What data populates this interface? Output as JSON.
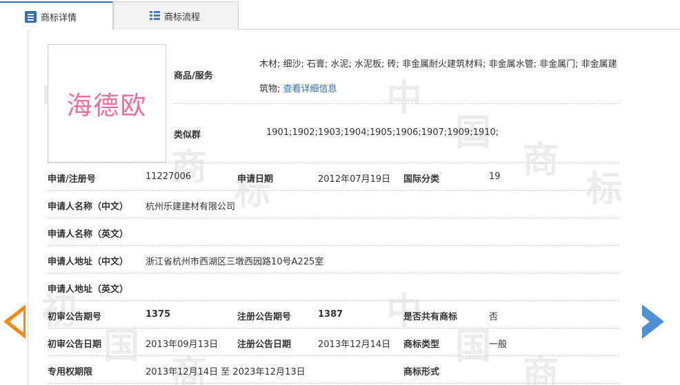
{
  "tabs": [
    {
      "label": "商标详情",
      "active": true,
      "icon": "document-list-icon"
    },
    {
      "label": "商标流程",
      "active": false,
      "icon": "grid-list-icon"
    }
  ],
  "logo": {
    "text": "海德欧"
  },
  "goods": {
    "label": "商品/服务",
    "text": "木材; 细沙; 石膏; 水泥; 水泥板; 砖; 非金属耐火建筑材料; 非金属水管; 非金属门; 非金属建筑物;",
    "link": "查看详细信息"
  },
  "similar_group": {
    "label": "类似群",
    "value": "1901;1902;1903;1904;1905;1906;1907;1909;1910;"
  },
  "fields": {
    "reg_no_label": "申请/注册号",
    "reg_no": "11227006",
    "apply_date_label": "申请日期",
    "apply_date": "2012年07月19日",
    "intl_class_label": "国际分类",
    "intl_class": "19",
    "applicant_cn_label": "申请人名称（中文）",
    "applicant_cn": "杭州乐建建材有限公司",
    "applicant_en_label": "申请人名称（英文）",
    "applicant_en": "",
    "address_cn_label": "申请人地址（中文）",
    "address_cn": "浙江省杭州市西湖区三墩西园路10号A225室",
    "address_en_label": "申请人地址（英文）",
    "address_en": "",
    "prelim_issue_label": "初审公告期号",
    "prelim_issue": "1375",
    "reg_issue_label": "注册公告期号",
    "reg_issue": "1387",
    "shared_label": "是否共有商标",
    "shared": "否",
    "prelim_date_label": "初审公告日期",
    "prelim_date": "2013年09月13日",
    "reg_date_label": "注册公告日期",
    "reg_date": "2013年12月14日",
    "tm_type_label": "商标类型",
    "tm_type": "一般",
    "exclusive_label": "专用权期限",
    "exclusive": "2013年12月14日 至 2023年12月13日",
    "tm_form_label": "商标形式",
    "tm_form": ""
  },
  "nav": {
    "prev": "arrow-left-icon",
    "next": "arrow-right-icon"
  },
  "colors": {
    "accent": "#2f6fb5",
    "link": "#2b6fb8",
    "logo": "#ef6d96",
    "prev_arrow": "#f2891a",
    "next_arrow": "#4f8fd6"
  }
}
